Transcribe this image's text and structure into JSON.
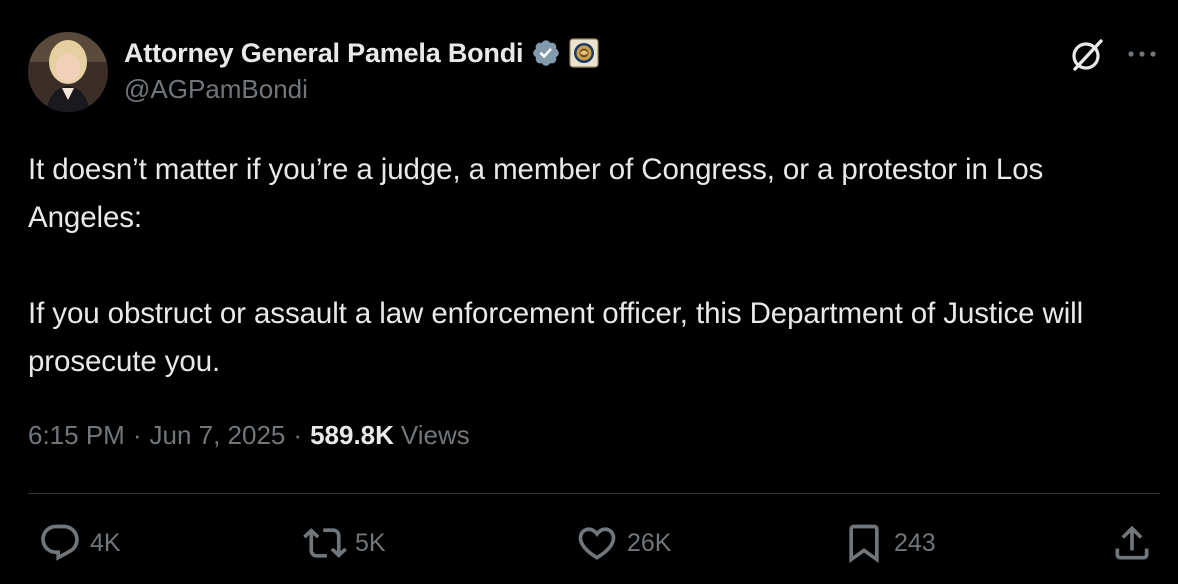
{
  "author": {
    "display_name": "Attorney General Pamela Bondi",
    "handle": "@AGPamBondi"
  },
  "tweet": {
    "paragraphs": [
      "It doesn’t matter if you’re a judge, a member of Congress, or a protestor in Los Angeles:",
      "If you obstruct or assault a law enforcement officer, this Department of Justice will prosecute you."
    ]
  },
  "meta": {
    "time": "6:15 PM",
    "date": "Jun 7, 2025",
    "views_count": "589.8K",
    "views_label": "Views",
    "separator": "·"
  },
  "actions": {
    "replies": "4K",
    "reposts": "5K",
    "likes": "26K",
    "bookmarks": "243"
  },
  "icons": {
    "verified": "verified-check-icon",
    "affiliate": "doj-seal-icon",
    "grok": "grok-icon",
    "more": "more-horizontal-icon",
    "reply": "reply-icon",
    "repost": "repost-icon",
    "like": "heart-icon",
    "bookmark": "bookmark-icon",
    "share": "share-icon"
  },
  "colors": {
    "background": "#000000",
    "text_primary": "#e7e9ea",
    "text_secondary": "#71767b",
    "divider": "#2f3336",
    "verified_badge": "#829aab"
  }
}
